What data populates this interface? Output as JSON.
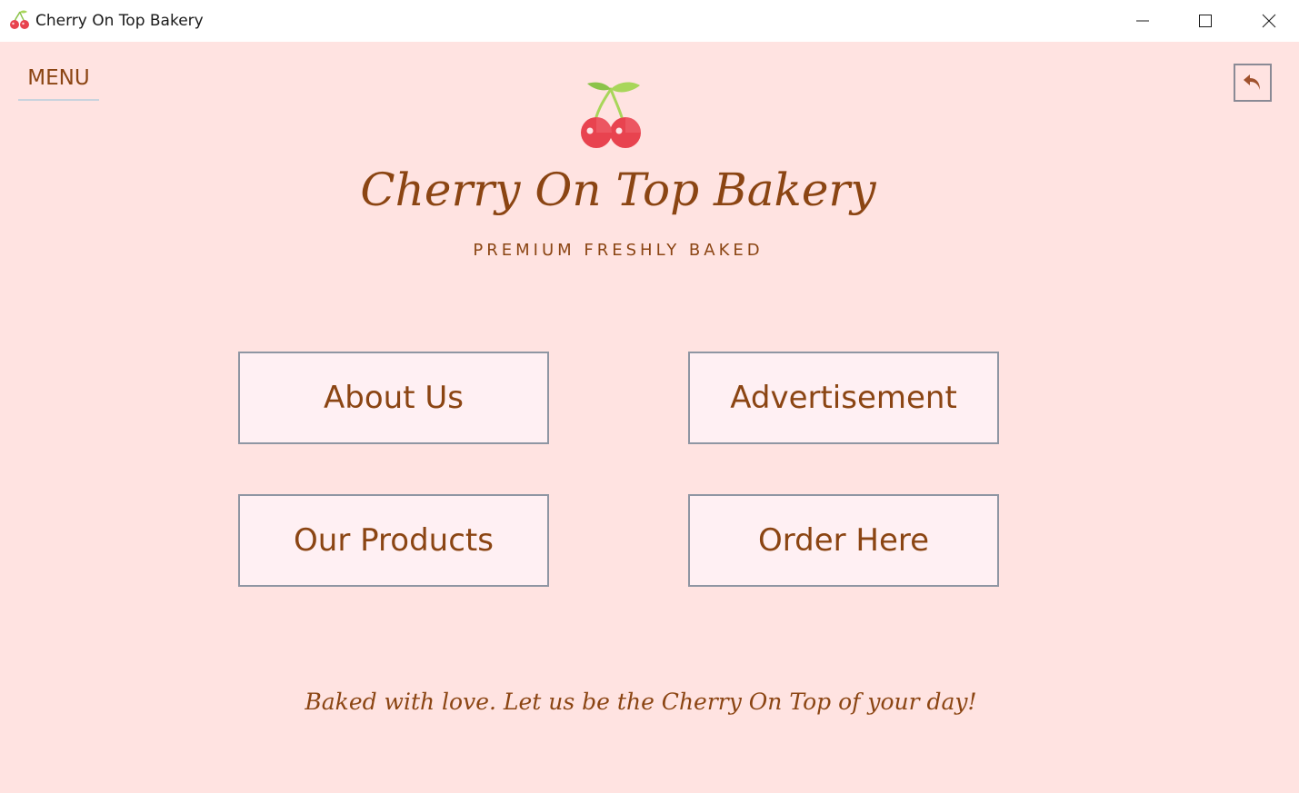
{
  "window": {
    "title": "Cherry On Top Bakery",
    "app_icon": "cherry-icon",
    "controls": [
      "minimize-icon",
      "maximize-icon",
      "close-icon"
    ]
  },
  "header": {
    "menu_label": "MENU",
    "back_icon": "undo-arrow-icon",
    "logo_icon": "cherry-icon"
  },
  "brand": {
    "title": "Cherry On Top Bakery",
    "tagline": "PREMIUM FRESHLY BAKED"
  },
  "nav": {
    "buttons": [
      {
        "label": "About Us"
      },
      {
        "label": "Advertisement"
      },
      {
        "label": "Our Products"
      },
      {
        "label": "Order Here"
      }
    ]
  },
  "footer": {
    "text": "Baked with love. Let us be the Cherry On Top of your day!"
  },
  "colors": {
    "background": "#ffe3e1",
    "text": "#8b4513",
    "button_bg": "#fff0f3",
    "button_border": "#8f96a3",
    "cherry_red": "#e8434f",
    "leaf_green": "#a8d65a"
  }
}
